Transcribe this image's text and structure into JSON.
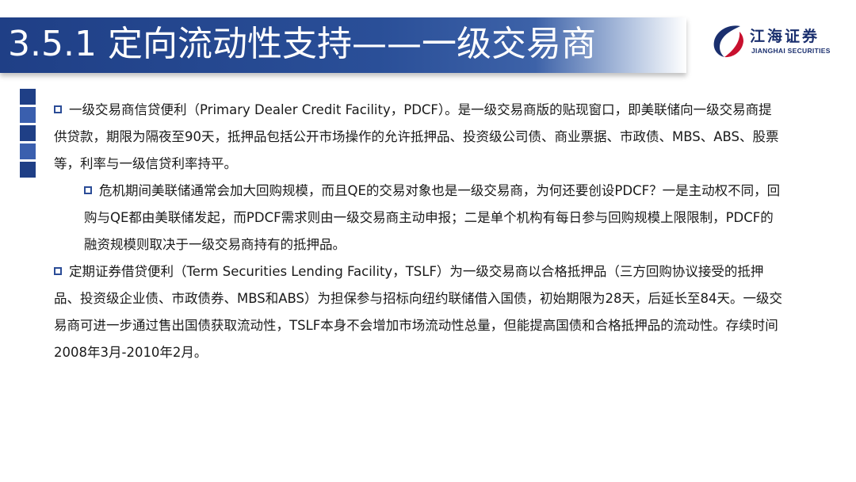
{
  "slide": {
    "title": "3.5.1 定向流动性支持——一级交易商",
    "logo": {
      "name": "江海证券",
      "subtitle": "JIANGHAI SECURITIES"
    },
    "colors": {
      "banner": "#1f3f86",
      "accent": "#2b4c97",
      "deco_squares": [
        "#1f3f86",
        "#3a5fae",
        "#1f3f86",
        "#3a5fae",
        "#1f3f86"
      ]
    },
    "paragraphs": [
      {
        "level": 1,
        "text": "一级交易商信贷便利（Primary Dealer Credit Facility，PDCF）。是一级交易商版的贴现窗口，即美联储向一级交易商提供贷款，期限为隔夜至90天，抵押品包括公开市场操作的允许抵押品、投资级公司债、商业票据、市政债、MBS、ABS、股票等，利率与一级信贷利率持平。"
      },
      {
        "level": 2,
        "text": "危机期间美联储通常会加大回购规模，而且QE的交易对象也是一级交易商，为何还要创设PDCF？一是主动权不同，回购与QE都由美联储发起，而PDCF需求则由一级交易商主动申报；二是单个机构有每日参与回购规模上限限制，PDCF的融资规模则取决于一级交易商持有的抵押品。"
      },
      {
        "level": 1,
        "text": "定期证券借贷便利（Term Securities Lending Facility，TSLF）为一级交易商以合格抵押品（三方回购协议接受的抵押品、投资级企业债、市政债券、MBS和ABS）为担保参与招标向纽约联储借入国债，初始期限为28天，后延长至84天。一级交易商可进一步通过售出国债获取流动性，TSLF本身不会增加市场流动性总量，但能提高国债和合格抵押品的流动性。存续时间2008年3月-2010年2月。"
      }
    ]
  }
}
